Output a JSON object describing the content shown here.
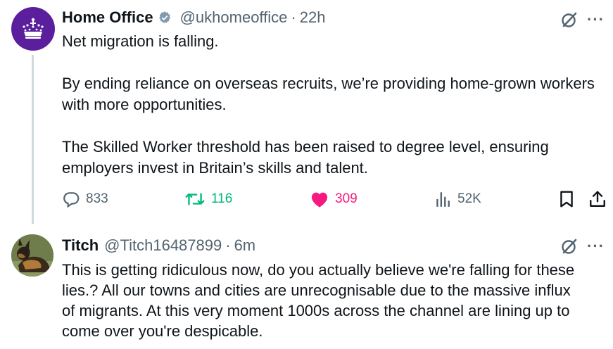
{
  "tweet1": {
    "author_name": "Home Office",
    "handle": "@ukhomeoffice",
    "separator": "·",
    "time": "22h",
    "paragraphs": [
      "Net migration is falling.",
      "By ending reliance on overseas recruits, we’re providing home-grown workers with more opportunities.",
      "The Skilled Worker threshold has been raised to degree level, ensuring employers invest in Britain’s skills and talent."
    ],
    "replies": "833",
    "reposts": "116",
    "likes": "309",
    "views": "52K",
    "colors": {
      "avatar_bg": "#5b1f9e",
      "repost_active": "#00ba7c",
      "like_active": "#f91880",
      "verified_badge": "#829aab"
    },
    "icons": [
      "crown-logo-icon",
      "verified-badge-icon",
      "grok-icon",
      "more-icon",
      "reply-icon",
      "repost-icon",
      "like-icon",
      "views-icon",
      "bookmark-icon",
      "share-icon"
    ]
  },
  "tweet2": {
    "author_name": "Titch",
    "handle": "@Titch16487899",
    "separator": "·",
    "time": "6m",
    "lines": [
      "This is getting ridiculous now, do you actually believe we're falling for these",
      "lies.? All our towns and cities are unrecognisable due to the massive influx",
      "of migrants. At this very moment 1000s across the channel are lining up to",
      "come over you're despicable."
    ],
    "icons": [
      "dog-avatar",
      "grok-icon",
      "more-icon"
    ]
  },
  "more_label": "···"
}
